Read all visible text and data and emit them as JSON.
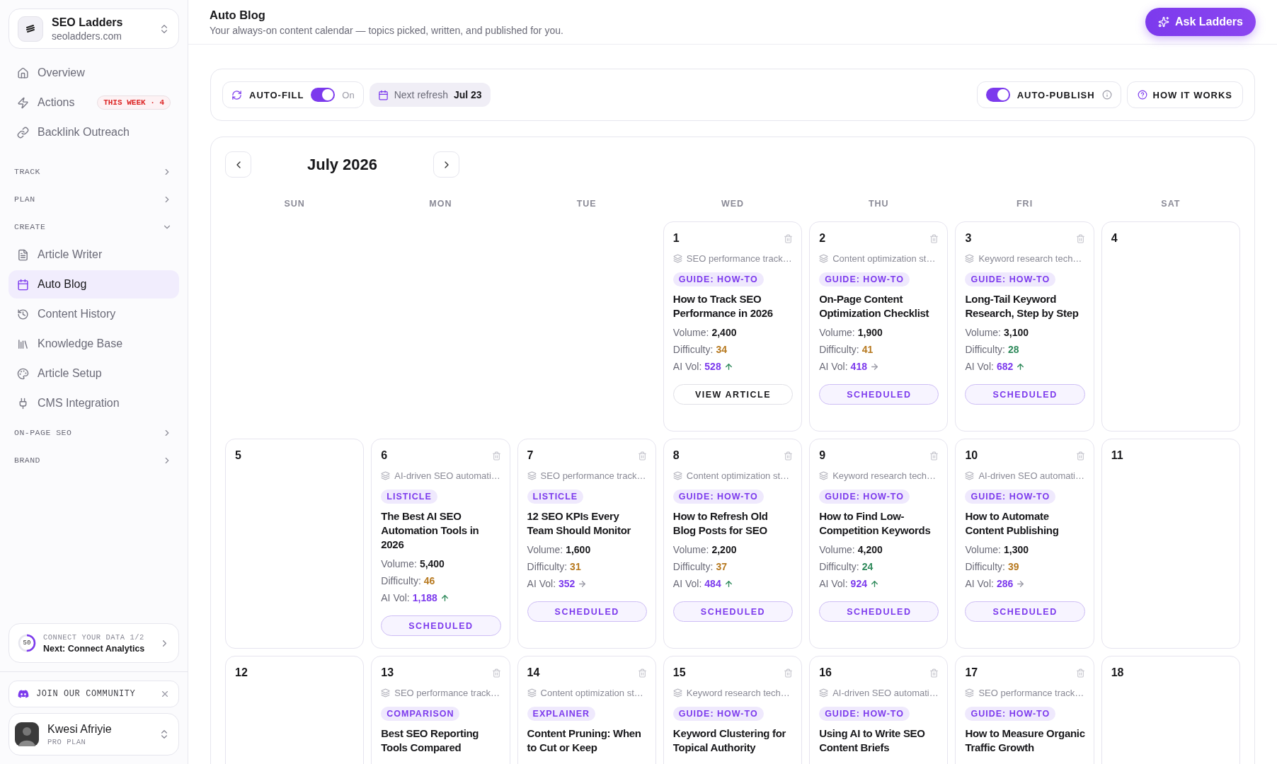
{
  "workspace": {
    "name": "SEO Ladders",
    "domain": "seoladders.com"
  },
  "sidebar": {
    "top_items": [
      {
        "label": "Overview",
        "selected": false
      },
      {
        "label": "Actions",
        "selected": false,
        "badge": "THIS WEEK · 4"
      },
      {
        "label": "Backlink Outreach",
        "selected": false
      }
    ],
    "sections": [
      {
        "label": "TRACK",
        "expanded": false
      },
      {
        "label": "PLAN",
        "expanded": false
      },
      {
        "label": "CREATE",
        "expanded": true,
        "items": [
          {
            "label": "Article Writer",
            "selected": false
          },
          {
            "label": "Auto Blog",
            "selected": true
          },
          {
            "label": "Content History",
            "selected": false
          },
          {
            "label": "Knowledge Base",
            "selected": false
          },
          {
            "label": "Article Setup",
            "selected": false
          },
          {
            "label": "CMS Integration",
            "selected": false
          }
        ]
      },
      {
        "label": "ON-PAGE SEO",
        "expanded": false
      },
      {
        "label": "BRAND",
        "expanded": false
      }
    ],
    "setup_card": {
      "progress": "50",
      "title": "CONNECT YOUR DATA",
      "step": "1/2",
      "next": "Next: Connect Analytics"
    },
    "community": {
      "label": "JOIN OUR COMMUNITY"
    },
    "user": {
      "name": "Kwesi Afriyie",
      "plan": "PRO PLAN"
    }
  },
  "header": {
    "title": "Auto Blog",
    "subtitle": "Your always-on content calendar — topics picked, written, and published for you.",
    "action": "Ask Ladders"
  },
  "toolbar": {
    "auto_fill": {
      "label": "AUTO-FILL",
      "on": true,
      "state_text": "On"
    },
    "next_refresh": {
      "label": "Next refresh",
      "date": "Jul 23"
    },
    "auto_publish": {
      "label": "AUTO-PUBLISH",
      "on": true
    },
    "help": "HOW IT WORKS"
  },
  "calendar": {
    "month": "July 2026",
    "weekdays": [
      "SUN",
      "MON",
      "TUE",
      "WED",
      "THU",
      "FRI",
      "SAT"
    ],
    "weeks": [
      {
        "days": [
          {
            "kind": "none"
          },
          {
            "kind": "none"
          },
          {
            "kind": "none"
          },
          {
            "kind": "article",
            "date": "1",
            "topic": "SEO performance track…",
            "tag": "GUIDE: HOW-TO",
            "title": "How to Track SEO Performance in 2026",
            "stats": [
              {
                "kind": "volume",
                "label": "Volume:",
                "value": "2,400"
              },
              {
                "kind": "difficulty",
                "label": "Difficulty:",
                "value": "34",
                "easy": false
              },
              {
                "kind": "ai_vol",
                "label": "AI Vol:",
                "value": "528",
                "trending_up": true
              }
            ],
            "action": {
              "kind": "view",
              "label": "VIEW ARTICLE"
            }
          },
          {
            "kind": "article",
            "date": "2",
            "topic": "Content optimization st…",
            "tag": "GUIDE: HOW-TO",
            "title": "On-Page Content Optimization Checklist",
            "stats": [
              {
                "kind": "volume",
                "label": "Volume:",
                "value": "1,900"
              },
              {
                "kind": "difficulty",
                "label": "Difficulty:",
                "value": "41",
                "easy": false
              },
              {
                "kind": "ai_vol",
                "label": "AI Vol:",
                "value": "418",
                "trending_up": false
              }
            ],
            "action": {
              "kind": "scheduled",
              "label": "SCHEDULED"
            }
          },
          {
            "kind": "article",
            "date": "3",
            "topic": "Keyword research tech…",
            "tag": "GUIDE: HOW-TO",
            "title": "Long-Tail Keyword Research, Step by Step",
            "stats": [
              {
                "kind": "volume",
                "label": "Volume:",
                "value": "3,100"
              },
              {
                "kind": "difficulty",
                "label": "Difficulty:",
                "value": "28",
                "easy": true
              },
              {
                "kind": "ai_vol",
                "label": "AI Vol:",
                "value": "682",
                "trending_up": true
              }
            ],
            "action": {
              "kind": "scheduled",
              "label": "SCHEDULED"
            }
          },
          {
            "kind": "empty",
            "date": "4"
          }
        ]
      },
      {
        "days": [
          {
            "kind": "empty",
            "date": "5"
          },
          {
            "kind": "article",
            "date": "6",
            "topic": "AI-driven SEO automati…",
            "tag": "LISTICLE",
            "title": "The Best AI SEO Automation Tools in 2026",
            "stats": [
              {
                "kind": "volume",
                "label": "Volume:",
                "value": "5,400"
              },
              {
                "kind": "difficulty",
                "label": "Difficulty:",
                "value": "46",
                "easy": false
              },
              {
                "kind": "ai_vol",
                "label": "AI Vol:",
                "value": "1,188",
                "trending_up": true
              }
            ],
            "action": {
              "kind": "scheduled",
              "label": "SCHEDULED"
            }
          },
          {
            "kind": "article",
            "date": "7",
            "topic": "SEO performance track…",
            "tag": "LISTICLE",
            "title": "12 SEO KPIs Every Team Should Monitor",
            "stats": [
              {
                "kind": "volume",
                "label": "Volume:",
                "value": "1,600"
              },
              {
                "kind": "difficulty",
                "label": "Difficulty:",
                "value": "31",
                "easy": false
              },
              {
                "kind": "ai_vol",
                "label": "AI Vol:",
                "value": "352",
                "trending_up": false
              }
            ],
            "action": {
              "kind": "scheduled",
              "label": "SCHEDULED"
            }
          },
          {
            "kind": "article",
            "date": "8",
            "topic": "Content optimization st…",
            "tag": "GUIDE: HOW-TO",
            "title": "How to Refresh Old Blog Posts for SEO",
            "stats": [
              {
                "kind": "volume",
                "label": "Volume:",
                "value": "2,200"
              },
              {
                "kind": "difficulty",
                "label": "Difficulty:",
                "value": "37",
                "easy": false
              },
              {
                "kind": "ai_vol",
                "label": "AI Vol:",
                "value": "484",
                "trending_up": true
              }
            ],
            "action": {
              "kind": "scheduled",
              "label": "SCHEDULED"
            }
          },
          {
            "kind": "article",
            "date": "9",
            "topic": "Keyword research tech…",
            "tag": "GUIDE: HOW-TO",
            "title": "How to Find Low-Competition Keywords",
            "stats": [
              {
                "kind": "volume",
                "label": "Volume:",
                "value": "4,200"
              },
              {
                "kind": "difficulty",
                "label": "Difficulty:",
                "value": "24",
                "easy": true
              },
              {
                "kind": "ai_vol",
                "label": "AI Vol:",
                "value": "924",
                "trending_up": true
              }
            ],
            "action": {
              "kind": "scheduled",
              "label": "SCHEDULED"
            }
          },
          {
            "kind": "article",
            "date": "10",
            "topic": "AI-driven SEO automati…",
            "tag": "GUIDE: HOW-TO",
            "title": "How to Automate Content Publishing",
            "stats": [
              {
                "kind": "volume",
                "label": "Volume:",
                "value": "1,300"
              },
              {
                "kind": "difficulty",
                "label": "Difficulty:",
                "value": "39",
                "easy": false
              },
              {
                "kind": "ai_vol",
                "label": "AI Vol:",
                "value": "286",
                "trending_up": false
              }
            ],
            "action": {
              "kind": "scheduled",
              "label": "SCHEDULED"
            }
          },
          {
            "kind": "empty",
            "date": "11"
          }
        ]
      },
      {
        "days": [
          {
            "kind": "empty",
            "date": "12"
          },
          {
            "kind": "article",
            "date": "13",
            "topic": "SEO performance track…",
            "tag": "COMPARISON",
            "title": "Best SEO Reporting Tools Compared"
          },
          {
            "kind": "article",
            "date": "14",
            "topic": "Content optimization st…",
            "tag": "EXPLAINER",
            "title": "Content Pruning: When to Cut or Keep"
          },
          {
            "kind": "article",
            "date": "15",
            "topic": "Keyword research tech…",
            "tag": "GUIDE: HOW-TO",
            "title": "Keyword Clustering for Topical Authority"
          },
          {
            "kind": "article",
            "date": "16",
            "topic": "AI-driven SEO automati…",
            "tag": "GUIDE: HOW-TO",
            "title": "Using AI to Write SEO Content Briefs"
          },
          {
            "kind": "article",
            "date": "17",
            "topic": "SEO performance track…",
            "tag": "GUIDE: HOW-TO",
            "title": "How to Measure Organic Traffic Growth"
          },
          {
            "kind": "empty",
            "date": "18"
          }
        ]
      }
    ]
  }
}
